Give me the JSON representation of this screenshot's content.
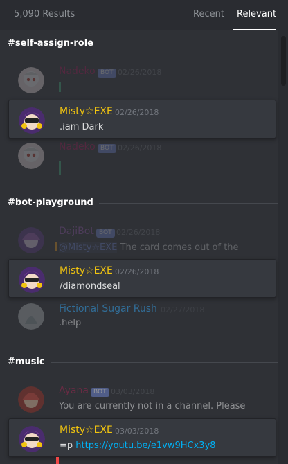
{
  "header": {
    "results": "5,090 Results",
    "tab_recent": "Recent",
    "tab_relevant": "Relevant"
  },
  "colors": {
    "background": "#2f3136",
    "misty_name": "#f1c40f",
    "nadeko_name": "#ad1457",
    "dajibot_name": "#9b59b6",
    "sugar_name": "#3498db",
    "ayana_name": "#e91e63",
    "link": "#00b0f4"
  },
  "channels": [
    {
      "name": "#self-assign-role",
      "messages": [
        {
          "author": "Nadeko",
          "bot": "BOT",
          "time": "02/26/2018",
          "content": "",
          "avatar": "nadeko-avatar"
        },
        {
          "author": "Misty☆EXE",
          "time": "02/26/2018",
          "content": ".iam Dark",
          "avatar": "misty-avatar"
        },
        {
          "author": "Nadeko",
          "bot": "BOT",
          "time": "02/26/2018",
          "content": "",
          "avatar": "nadeko-avatar"
        }
      ]
    },
    {
      "name": "#bot-playground",
      "messages": [
        {
          "author": "DajiBot",
          "bot": "BOT",
          "time": "02/26/2018",
          "mention": "@Misty☆EXE",
          "content": "The card comes out of the",
          "avatar": "dajibot-avatar"
        },
        {
          "author": "Misty☆EXE",
          "time": "02/26/2018",
          "content": "/diamondseal",
          "avatar": "misty-avatar"
        },
        {
          "author": "Fictional Sugar Rush",
          "time": "02/27/2018",
          "content": ".help",
          "avatar": "sugar-avatar"
        }
      ]
    },
    {
      "name": "#music",
      "messages": [
        {
          "author": "Ayana",
          "bot": "BOT",
          "time": "03/03/2018",
          "content": "You are currently not in a channel. Please",
          "avatar": "ayana-avatar"
        },
        {
          "author": "Misty☆EXE",
          "time": "03/03/2018",
          "prefix": "=p",
          "link": "https://youtu.be/e1vw9HCx3y8",
          "avatar": "misty-avatar"
        }
      ]
    }
  ]
}
